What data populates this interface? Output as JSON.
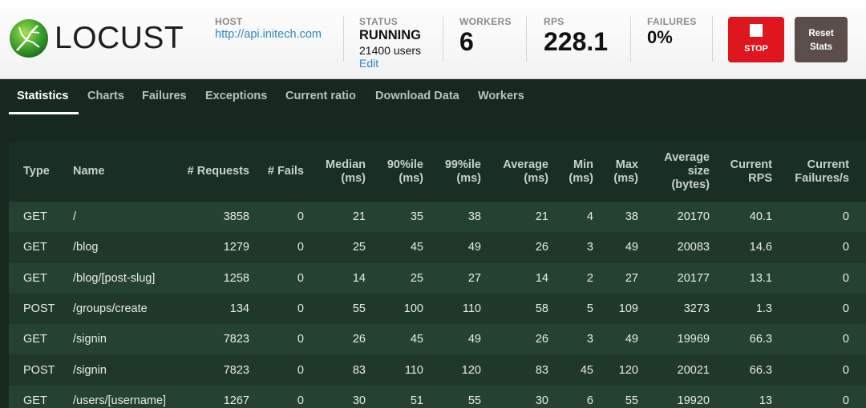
{
  "app": {
    "name": "LOCUST"
  },
  "header": {
    "host_label": "HOST",
    "host_value": "http://api.initech.com",
    "status_label": "STATUS",
    "status_value": "RUNNING",
    "users_value": "21400 users",
    "edit_label": "Edit",
    "workers_label": "WORKERS",
    "workers_value": "6",
    "rps_label": "RPS",
    "rps_value": "228.1",
    "failures_label": "FAILURES",
    "failures_value": "0%",
    "stop_label": "STOP",
    "reset_label_1": "Reset",
    "reset_label_2": "Stats"
  },
  "colors": {
    "stop_button": "#e0161f",
    "reset_button": "#5b4d49",
    "link": "#2e87c8",
    "background": "#17281f"
  },
  "tabs": [
    {
      "label": "Statistics",
      "active": true
    },
    {
      "label": "Charts"
    },
    {
      "label": "Failures"
    },
    {
      "label": "Exceptions"
    },
    {
      "label": "Current ratio"
    },
    {
      "label": "Download Data"
    },
    {
      "label": "Workers"
    }
  ],
  "table": {
    "headers": {
      "type": "Type",
      "name": "Name",
      "requests": "# Requests",
      "fails": "# Fails",
      "median_1": "Median",
      "median_2": "(ms)",
      "p90_1": "90%ile",
      "p90_2": "(ms)",
      "p99_1": "99%ile",
      "p99_2": "(ms)",
      "avg_1": "Average",
      "avg_2": "(ms)",
      "min_1": "Min",
      "min_2": "(ms)",
      "max_1": "Max",
      "max_2": "(ms)",
      "size_1": "Average",
      "size_2": "size",
      "size_3": "(bytes)",
      "rps_1": "Current",
      "rps_2": "RPS",
      "fps_1": "Current",
      "fps_2": "Failures/s"
    },
    "rows": [
      {
        "type": "GET",
        "name": "/",
        "requests": "3858",
        "fails": "0",
        "median": "21",
        "p90": "35",
        "p99": "38",
        "avg": "21",
        "min": "4",
        "max": "38",
        "size": "20170",
        "rps": "40.1",
        "fps": "0"
      },
      {
        "type": "GET",
        "name": "/blog",
        "requests": "1279",
        "fails": "0",
        "median": "25",
        "p90": "45",
        "p99": "49",
        "avg": "26",
        "min": "3",
        "max": "49",
        "size": "20083",
        "rps": "14.6",
        "fps": "0"
      },
      {
        "type": "GET",
        "name": "/blog/[post-slug]",
        "requests": "1258",
        "fails": "0",
        "median": "14",
        "p90": "25",
        "p99": "27",
        "avg": "14",
        "min": "2",
        "max": "27",
        "size": "20177",
        "rps": "13.1",
        "fps": "0"
      },
      {
        "type": "POST",
        "name": "/groups/create",
        "requests": "134",
        "fails": "0",
        "median": "55",
        "p90": "100",
        "p99": "110",
        "avg": "58",
        "min": "5",
        "max": "109",
        "size": "3273",
        "rps": "1.3",
        "fps": "0"
      },
      {
        "type": "GET",
        "name": "/signin",
        "requests": "7823",
        "fails": "0",
        "median": "26",
        "p90": "45",
        "p99": "49",
        "avg": "26",
        "min": "3",
        "max": "49",
        "size": "19969",
        "rps": "66.3",
        "fps": "0"
      },
      {
        "type": "POST",
        "name": "/signin",
        "requests": "7823",
        "fails": "0",
        "median": "83",
        "p90": "110",
        "p99": "120",
        "avg": "83",
        "min": "45",
        "max": "120",
        "size": "20021",
        "rps": "66.3",
        "fps": "0"
      },
      {
        "type": "GET",
        "name": "/users/[username]",
        "requests": "1267",
        "fails": "0",
        "median": "30",
        "p90": "51",
        "p99": "55",
        "avg": "30",
        "min": "6",
        "max": "55",
        "size": "19920",
        "rps": "13",
        "fps": "0"
      }
    ]
  }
}
